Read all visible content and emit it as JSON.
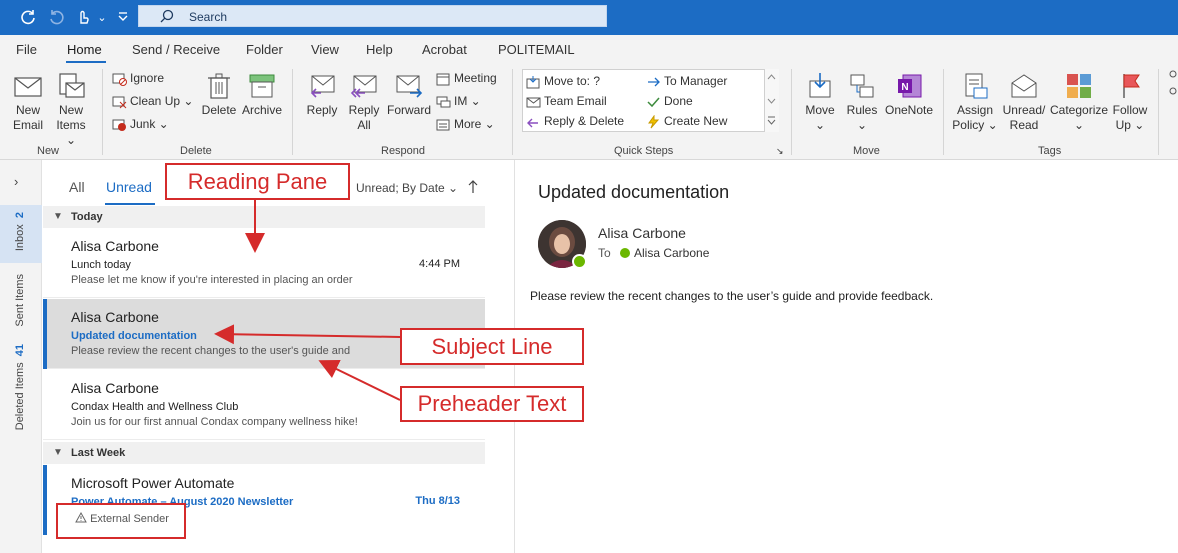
{
  "search": {
    "placeholder": "Search"
  },
  "tabs": [
    "File",
    "Home",
    "Send / Receive",
    "Folder",
    "View",
    "Help",
    "Acrobat",
    "POLITEMAIL"
  ],
  "ribbon": {
    "new_email": [
      "New",
      "Email"
    ],
    "new_items": [
      "New",
      "Items ⌄"
    ],
    "ignore": "Ignore",
    "clean_up": "Clean Up ⌄",
    "junk": "Junk ⌄",
    "delete": "Delete",
    "archive": "Archive",
    "reply": "Reply",
    "reply_all": [
      "Reply",
      "All"
    ],
    "forward": "Forward",
    "meeting": "Meeting",
    "im": "IM ⌄",
    "more": "More ⌄",
    "qs_move_to": "Move to: ?",
    "qs_team_email": "Team Email",
    "qs_reply_delete": "Reply & Delete",
    "qs_to_manager": "To Manager",
    "qs_done": "Done",
    "qs_create_new": "Create New",
    "move": [
      "Move",
      "⌄"
    ],
    "rules": [
      "Rules",
      "⌄"
    ],
    "onenote": "OneNote",
    "assign_policy": [
      "Assign",
      "Policy ⌄"
    ],
    "unread_read": [
      "Unread/",
      "Read"
    ],
    "categorize": [
      "Categorize",
      "⌄"
    ],
    "follow_up": [
      "Follow",
      "Up ⌄"
    ],
    "groups": {
      "new": "New",
      "delete": "Delete",
      "respond": "Respond",
      "quick_steps": "Quick Steps",
      "move": "Move",
      "tags": "Tags"
    }
  },
  "leftnav": {
    "inbox": "Inbox",
    "inbox_count": "2",
    "sent": "Sent Items",
    "deleted": "Deleted Items",
    "deleted_count": "41"
  },
  "msglist": {
    "filter_all": "All",
    "filter_unread": "Unread",
    "sort": "Unread; By Date ⌄",
    "group_today": "Today",
    "group_last_week": "Last Week",
    "items": [
      {
        "sender": "Alisa Carbone",
        "subject": "Lunch today",
        "preview": "Please let me know if you're interested in placing an order",
        "time": "4:44 PM"
      },
      {
        "sender": "Alisa Carbone",
        "subject": "Updated documentation",
        "preview": "Please review the recent changes to the user's guide and",
        "time": ""
      },
      {
        "sender": "Alisa Carbone",
        "subject": "Condax Health and Wellness Club",
        "preview": "Join us for our first annual Condax company wellness hike!",
        "time": ""
      },
      {
        "sender": "Microsoft Power Automate",
        "subject": "Power Automate – August 2020 Newsletter",
        "preview": "External Sender",
        "time": "Thu 8/13"
      }
    ]
  },
  "reading": {
    "subject": "Updated documentation",
    "from": "Alisa Carbone",
    "to_label": "To",
    "to_name": "Alisa Carbone",
    "body": "Please review the recent changes to the user’s guide and provide feedback."
  },
  "annotations": {
    "reading_pane": "Reading Pane",
    "subject_line": "Subject Line",
    "preheader_text": "Preheader Text"
  },
  "colors": {
    "accent": "#1c6cc4",
    "annotation": "#d52b2b",
    "presence": "#6bb700"
  }
}
